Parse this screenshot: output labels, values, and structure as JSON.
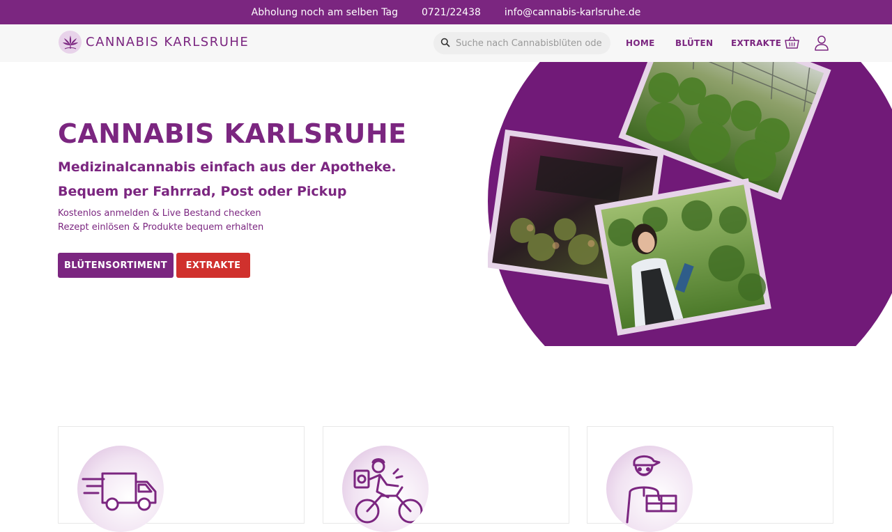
{
  "topbar": {
    "pickup": "Abholung noch am selben Tag",
    "phone": "0721/22438",
    "email": "info@cannabis-karlsruhe.de"
  },
  "header": {
    "logo_text": "CANNABIS KARLSRUHE",
    "search_placeholder": "Suche nach Cannabisblüten oder ...",
    "nav": [
      "HOME",
      "BLÜTEN",
      "EXTRAKTE"
    ],
    "icons": [
      "basket-icon",
      "user-icon",
      "search-icon"
    ]
  },
  "hero": {
    "title": "CANNABIS KARLSRUHE",
    "subtitle1": "Medizinalcannabis einfach aus der Apotheke.",
    "subtitle2": "Bequem per Fahrrad, Post oder Pickup",
    "line1": "Kostenlos anmelden & Live Bestand checken",
    "line2": "Rezept einlösen & Produkte bequem erhalten",
    "button_primary": "BLÜTENSORTIMENT",
    "button_secondary": "EXTRAKTE"
  },
  "colors": {
    "brand": "#7b2680",
    "accent_red": "#d0312d",
    "navbar_bg": "#f7f7f7"
  },
  "features": [
    {
      "icon": "delivery-truck-icon"
    },
    {
      "icon": "bike-courier-icon"
    },
    {
      "icon": "parcel-courier-icon"
    }
  ]
}
